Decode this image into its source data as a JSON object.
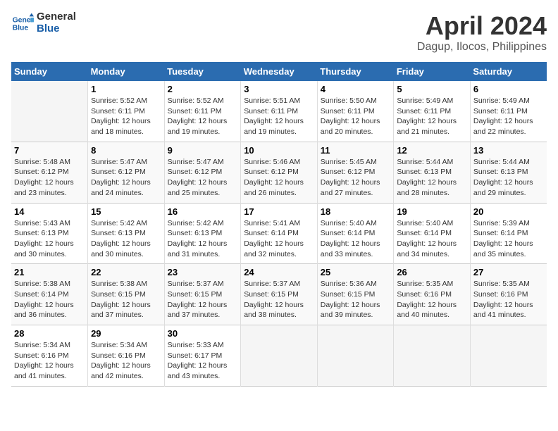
{
  "logo": {
    "line1": "General",
    "line2": "Blue"
  },
  "title": "April 2024",
  "subtitle": "Dagup, Ilocos, Philippines",
  "weekdays": [
    "Sunday",
    "Monday",
    "Tuesday",
    "Wednesday",
    "Thursday",
    "Friday",
    "Saturday"
  ],
  "weeks": [
    [
      {
        "num": "",
        "info": ""
      },
      {
        "num": "1",
        "info": "Sunrise: 5:52 AM\nSunset: 6:11 PM\nDaylight: 12 hours\nand 18 minutes."
      },
      {
        "num": "2",
        "info": "Sunrise: 5:52 AM\nSunset: 6:11 PM\nDaylight: 12 hours\nand 19 minutes."
      },
      {
        "num": "3",
        "info": "Sunrise: 5:51 AM\nSunset: 6:11 PM\nDaylight: 12 hours\nand 19 minutes."
      },
      {
        "num": "4",
        "info": "Sunrise: 5:50 AM\nSunset: 6:11 PM\nDaylight: 12 hours\nand 20 minutes."
      },
      {
        "num": "5",
        "info": "Sunrise: 5:49 AM\nSunset: 6:11 PM\nDaylight: 12 hours\nand 21 minutes."
      },
      {
        "num": "6",
        "info": "Sunrise: 5:49 AM\nSunset: 6:11 PM\nDaylight: 12 hours\nand 22 minutes."
      }
    ],
    [
      {
        "num": "7",
        "info": "Sunrise: 5:48 AM\nSunset: 6:12 PM\nDaylight: 12 hours\nand 23 minutes."
      },
      {
        "num": "8",
        "info": "Sunrise: 5:47 AM\nSunset: 6:12 PM\nDaylight: 12 hours\nand 24 minutes."
      },
      {
        "num": "9",
        "info": "Sunrise: 5:47 AM\nSunset: 6:12 PM\nDaylight: 12 hours\nand 25 minutes."
      },
      {
        "num": "10",
        "info": "Sunrise: 5:46 AM\nSunset: 6:12 PM\nDaylight: 12 hours\nand 26 minutes."
      },
      {
        "num": "11",
        "info": "Sunrise: 5:45 AM\nSunset: 6:12 PM\nDaylight: 12 hours\nand 27 minutes."
      },
      {
        "num": "12",
        "info": "Sunrise: 5:44 AM\nSunset: 6:13 PM\nDaylight: 12 hours\nand 28 minutes."
      },
      {
        "num": "13",
        "info": "Sunrise: 5:44 AM\nSunset: 6:13 PM\nDaylight: 12 hours\nand 29 minutes."
      }
    ],
    [
      {
        "num": "14",
        "info": "Sunrise: 5:43 AM\nSunset: 6:13 PM\nDaylight: 12 hours\nand 30 minutes."
      },
      {
        "num": "15",
        "info": "Sunrise: 5:42 AM\nSunset: 6:13 PM\nDaylight: 12 hours\nand 30 minutes."
      },
      {
        "num": "16",
        "info": "Sunrise: 5:42 AM\nSunset: 6:13 PM\nDaylight: 12 hours\nand 31 minutes."
      },
      {
        "num": "17",
        "info": "Sunrise: 5:41 AM\nSunset: 6:14 PM\nDaylight: 12 hours\nand 32 minutes."
      },
      {
        "num": "18",
        "info": "Sunrise: 5:40 AM\nSunset: 6:14 PM\nDaylight: 12 hours\nand 33 minutes."
      },
      {
        "num": "19",
        "info": "Sunrise: 5:40 AM\nSunset: 6:14 PM\nDaylight: 12 hours\nand 34 minutes."
      },
      {
        "num": "20",
        "info": "Sunrise: 5:39 AM\nSunset: 6:14 PM\nDaylight: 12 hours\nand 35 minutes."
      }
    ],
    [
      {
        "num": "21",
        "info": "Sunrise: 5:38 AM\nSunset: 6:14 PM\nDaylight: 12 hours\nand 36 minutes."
      },
      {
        "num": "22",
        "info": "Sunrise: 5:38 AM\nSunset: 6:15 PM\nDaylight: 12 hours\nand 37 minutes."
      },
      {
        "num": "23",
        "info": "Sunrise: 5:37 AM\nSunset: 6:15 PM\nDaylight: 12 hours\nand 37 minutes."
      },
      {
        "num": "24",
        "info": "Sunrise: 5:37 AM\nSunset: 6:15 PM\nDaylight: 12 hours\nand 38 minutes."
      },
      {
        "num": "25",
        "info": "Sunrise: 5:36 AM\nSunset: 6:15 PM\nDaylight: 12 hours\nand 39 minutes."
      },
      {
        "num": "26",
        "info": "Sunrise: 5:35 AM\nSunset: 6:16 PM\nDaylight: 12 hours\nand 40 minutes."
      },
      {
        "num": "27",
        "info": "Sunrise: 5:35 AM\nSunset: 6:16 PM\nDaylight: 12 hours\nand 41 minutes."
      }
    ],
    [
      {
        "num": "28",
        "info": "Sunrise: 5:34 AM\nSunset: 6:16 PM\nDaylight: 12 hours\nand 41 minutes."
      },
      {
        "num": "29",
        "info": "Sunrise: 5:34 AM\nSunset: 6:16 PM\nDaylight: 12 hours\nand 42 minutes."
      },
      {
        "num": "30",
        "info": "Sunrise: 5:33 AM\nSunset: 6:17 PM\nDaylight: 12 hours\nand 43 minutes."
      },
      {
        "num": "",
        "info": ""
      },
      {
        "num": "",
        "info": ""
      },
      {
        "num": "",
        "info": ""
      },
      {
        "num": "",
        "info": ""
      }
    ]
  ]
}
